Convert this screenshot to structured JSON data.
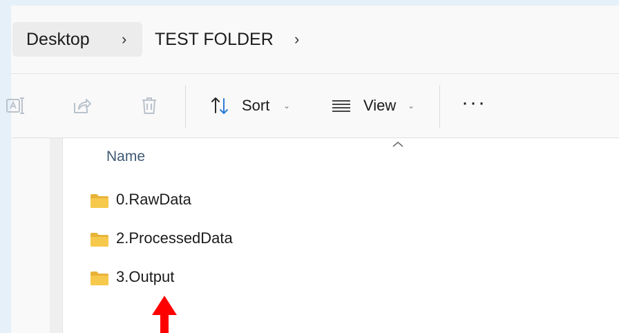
{
  "breadcrumb": {
    "items": [
      "Desktop",
      "TEST FOLDER"
    ],
    "separator": "›"
  },
  "toolbar": {
    "sort_label": "Sort",
    "view_label": "View",
    "more_label": "···",
    "dropdown_glyph": "⌄"
  },
  "file_list": {
    "column_header": "Name",
    "items": [
      {
        "name": "0.RawData",
        "type": "folder"
      },
      {
        "name": "2.ProcessedData",
        "type": "folder"
      },
      {
        "name": "3.Output",
        "type": "folder"
      }
    ]
  },
  "colors": {
    "folder": "#f3c54a",
    "annotation_arrow": "#ff0000",
    "header_text": "#3f5a75"
  },
  "icons": [
    "rename-icon",
    "share-icon",
    "delete-icon",
    "sort-icon",
    "view-icon",
    "more-icon",
    "folder-icon",
    "sort-caret-icon",
    "annotation-arrow-icon"
  ]
}
